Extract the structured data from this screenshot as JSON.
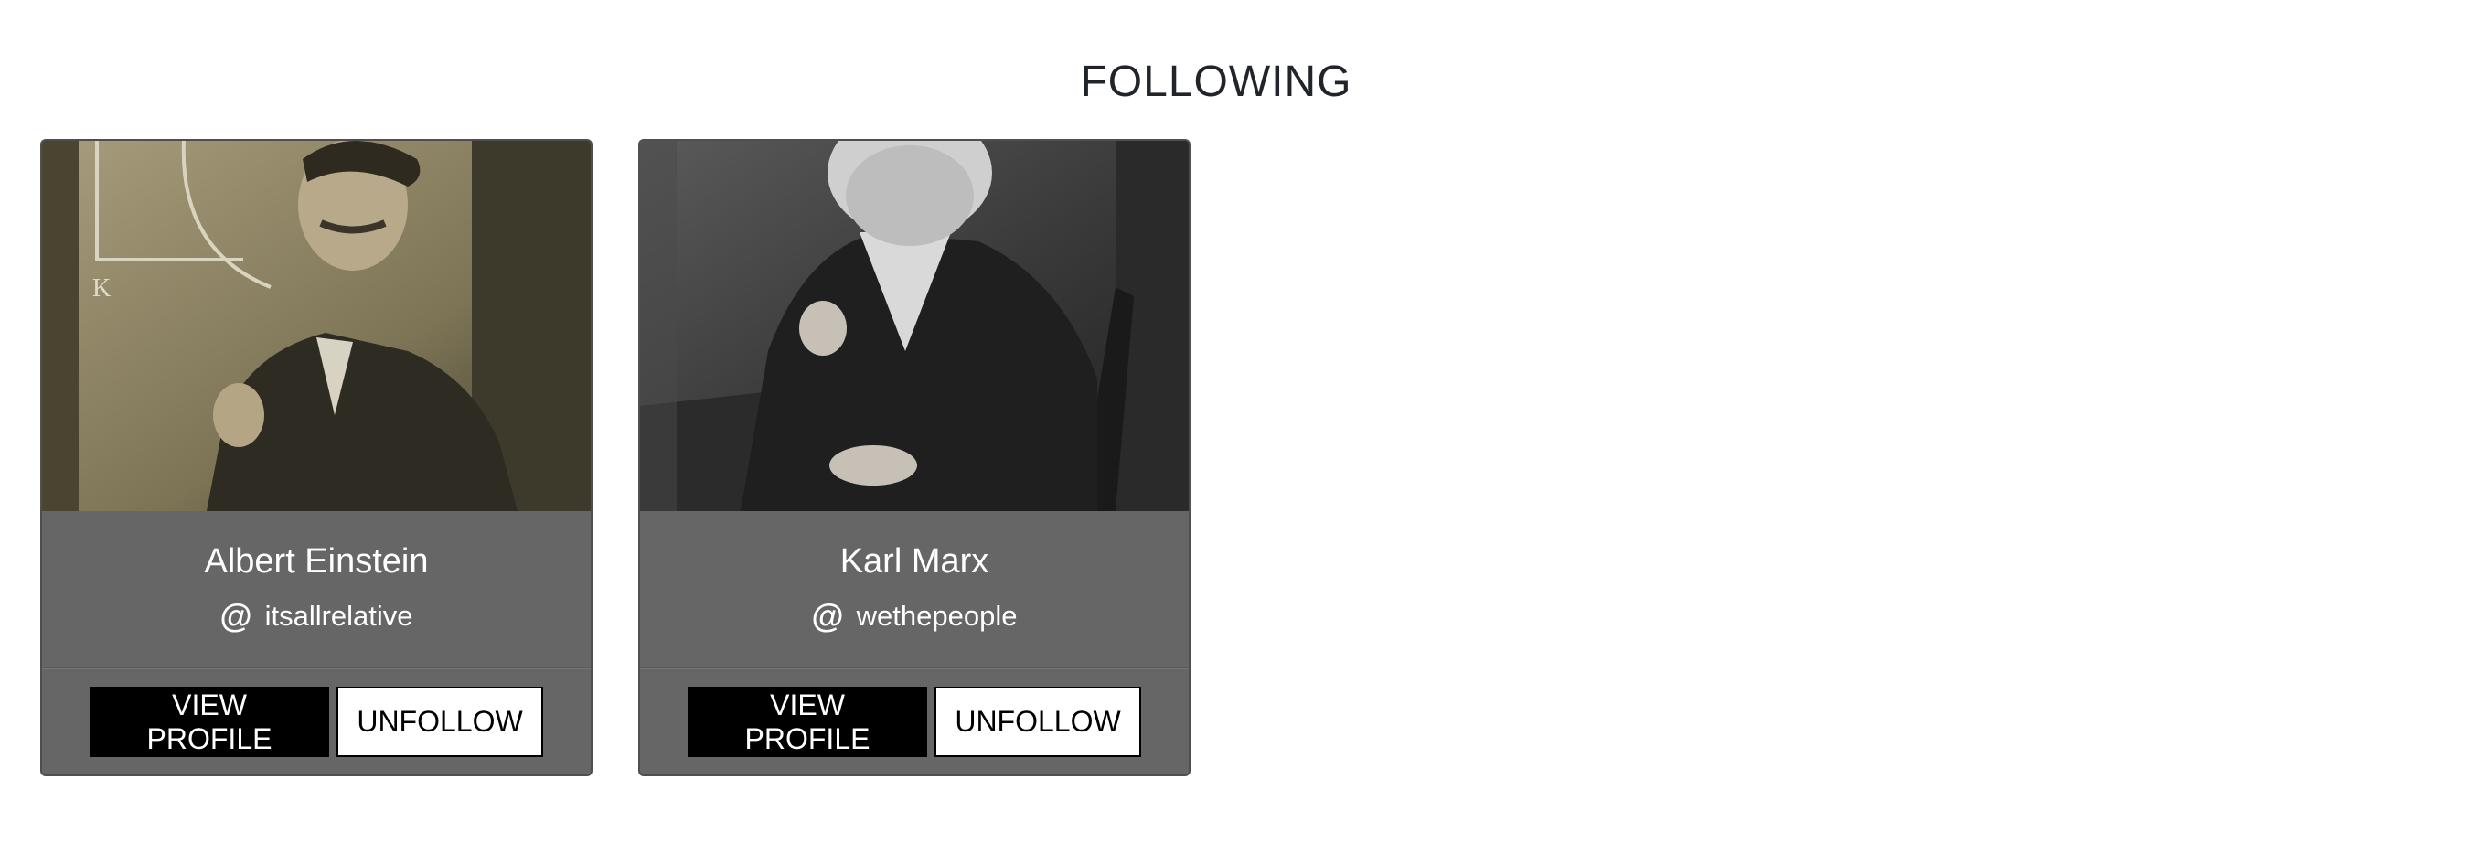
{
  "page": {
    "title": "FOLLOWING"
  },
  "cards": [
    {
      "name": "Albert Einstein",
      "handle": "itsallrelative",
      "at_symbol": "@",
      "view_label": "VIEW PROFILE",
      "unfollow_label": "UNFOLLOW",
      "photo_alt": "Albert Einstein photo"
    },
    {
      "name": "Karl Marx",
      "handle": "wethepeople",
      "at_symbol": "@",
      "view_label": "VIEW PROFILE",
      "unfollow_label": "UNFOLLOW",
      "photo_alt": "Karl Marx photo"
    }
  ],
  "colors": {
    "card_bg": "#666666",
    "primary_button": "#000000",
    "secondary_button": "#ffffff"
  }
}
